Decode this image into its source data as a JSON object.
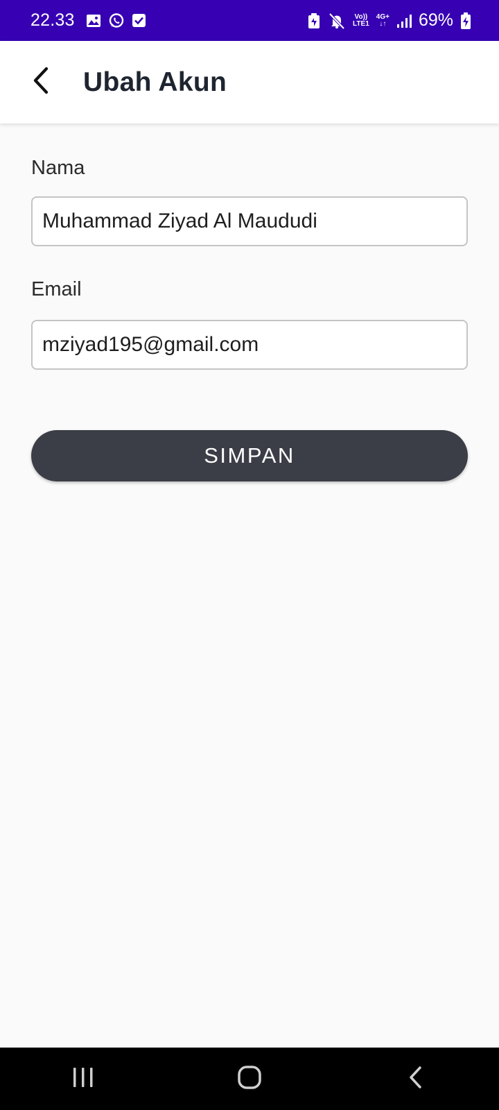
{
  "status_bar": {
    "time": "22.33",
    "volte_top": "Vo))",
    "volte_bottom": "LTE1",
    "network_type": "4G+",
    "battery_percent": "69%",
    "background_color": "#3700b3"
  },
  "app_bar": {
    "title": "Ubah Akun",
    "back_icon": "chevron-left-icon"
  },
  "form": {
    "name_label": "Nama",
    "name_value": "Muhammad Ziyad Al Maududi",
    "email_label": "Email",
    "email_value": "mziyad195@gmail.com",
    "save_label": "SIMPAN",
    "button_color": "#3b3e46"
  },
  "nav_bar": {
    "recents_icon": "recents-icon",
    "home_icon": "home-icon",
    "back_icon": "back-icon"
  }
}
